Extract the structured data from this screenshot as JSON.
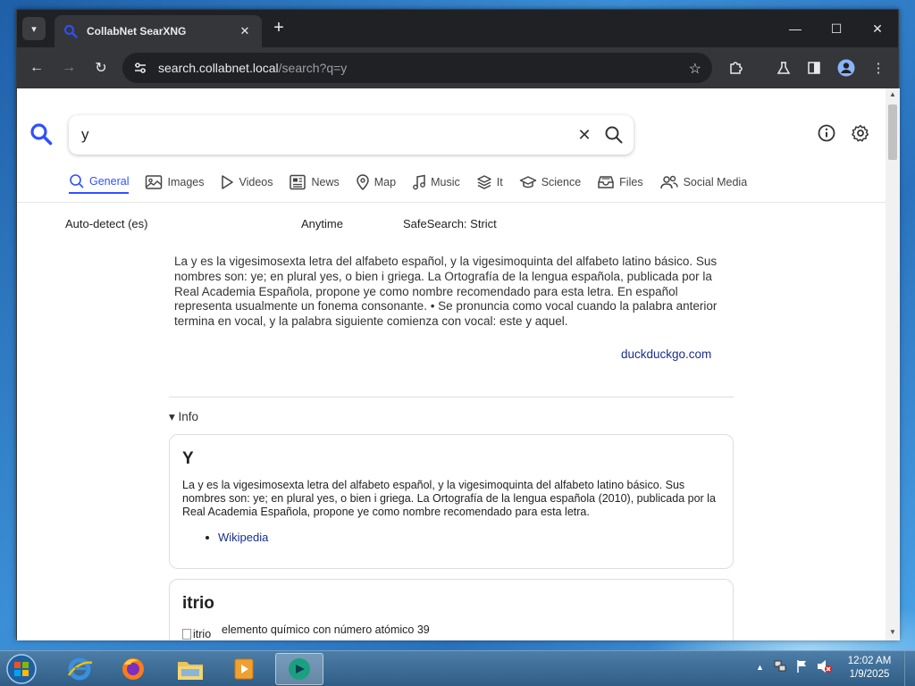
{
  "browser": {
    "tab_title": "CollabNet SearXNG",
    "url_host": "search.collabnet.local",
    "url_path": "/search?q=y"
  },
  "search": {
    "query": "y",
    "categories": [
      {
        "label": "General",
        "icon": "search-icon",
        "active": true
      },
      {
        "label": "Images",
        "icon": "image-icon"
      },
      {
        "label": "Videos",
        "icon": "play-icon"
      },
      {
        "label": "News",
        "icon": "newspaper-icon"
      },
      {
        "label": "Map",
        "icon": "map-pin-icon"
      },
      {
        "label": "Music",
        "icon": "music-note-icon"
      },
      {
        "label": "It",
        "icon": "layers-icon"
      },
      {
        "label": "Science",
        "icon": "graduation-cap-icon"
      },
      {
        "label": "Files",
        "icon": "file-tray-icon"
      },
      {
        "label": "Social Media",
        "icon": "people-icon"
      }
    ],
    "filters": {
      "language": "Auto-detect (es)",
      "time": "Anytime",
      "safesearch": "SafeSearch: Strict"
    }
  },
  "answer": {
    "text": "La y es la vigesimosexta letra del alfabeto español, y la vigesimoquinta del alfabeto latino básico. Sus nombres son: ye; en plural yes, o bien i griega. La Ortografía de la lengua española, publicada por la Real Academia Española, propone ye como nombre recomendado para esta letra. En español representa usualmente un fonema consonante. • Se pronuncia como vocal cuando la palabra anterior termina en vocal, y la palabra siguiente comienza con vocal: este y aquel.",
    "source": "duckduckgo.com"
  },
  "infobox": {
    "toggle_label": "Info",
    "cards": [
      {
        "title": "Y",
        "text": "La y es la vigesimosexta letra del alfabeto español, y la vigesimoquinta del alfabeto latino básico. Sus nombres son: ye; en plural yes, o bien i griega. La Ortografía de la lengua española (2010), publicada por la Real Academia Española, propone ye como nombre recomendado para esta letra.",
        "link": "Wikipedia"
      },
      {
        "title": "itrio",
        "image_alt": "itrio",
        "text": "elemento químico con número atómico 39"
      }
    ]
  },
  "taskbar": {
    "clock_time": "12:02 AM",
    "clock_date": "1/9/2025"
  },
  "colors": {
    "accent": "#3050ff",
    "link": "#1a2d8c"
  }
}
